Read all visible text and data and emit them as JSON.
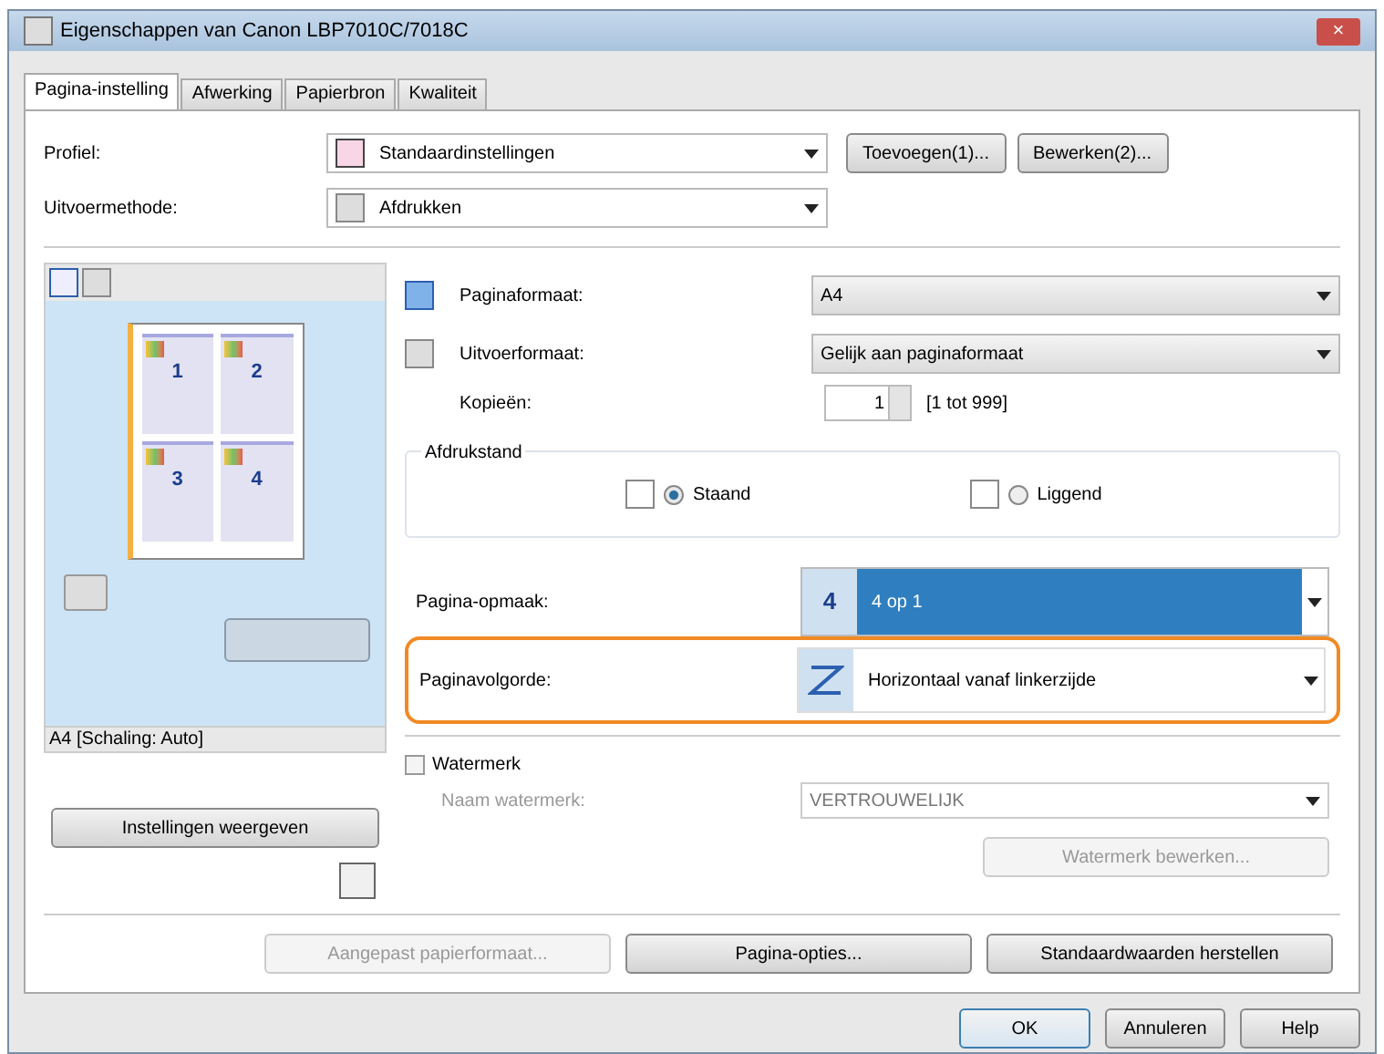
{
  "window": {
    "title": "Eigenschappen van Canon LBP7010C/7018C",
    "close": "×"
  },
  "tabs": [
    {
      "label": "Pagina-instelling",
      "selected": true
    },
    {
      "label": "Afwerking",
      "selected": false
    },
    {
      "label": "Papierbron",
      "selected": false
    },
    {
      "label": "Kwaliteit",
      "selected": false
    }
  ],
  "profile": {
    "label": "Profiel:",
    "value": "Standaardinstellingen",
    "buttons": [
      "Toevoegen(1)...",
      "Bewerken(2)..."
    ]
  },
  "output_method": {
    "label": "Uitvoermethode:",
    "value": "Afdrukken"
  },
  "preview": {
    "pages": [
      "1",
      "2",
      "3",
      "4"
    ],
    "caption": "A4 [Schaling: Auto]",
    "show_settings": "Instellingen weergeven"
  },
  "page_size": {
    "label": "Paginaformaat:",
    "value": "A4"
  },
  "output_size": {
    "label": "Uitvoerformaat:",
    "value": "Gelijk aan paginaformaat"
  },
  "copies": {
    "label": "Kopieën:",
    "value": "1",
    "range": "[1 tot 999]"
  },
  "orientation": {
    "label": "Afdrukstand",
    "options": [
      {
        "label": "Staand",
        "selected": true
      },
      {
        "label": "Liggend",
        "selected": false
      }
    ]
  },
  "layout": {
    "label": "Pagina-opmaak:",
    "badge": "4",
    "value": "4 op 1"
  },
  "order": {
    "label": "Paginavolgorde:",
    "value": "Horizontaal vanaf linkerzijde",
    "highlighted": true
  },
  "watermark": {
    "label": "Watermerk",
    "checked": false,
    "name_label": "Naam watermerk:",
    "name_value": "VERTROUWELIJK",
    "edit_button": "Watermerk bewerken..."
  },
  "panel_buttons": [
    {
      "label": "Aangepast papierformaat...",
      "disabled": true
    },
    {
      "label": "Pagina-opties...",
      "disabled": false
    },
    {
      "label": "Standaardwaarden herstellen",
      "disabled": false
    }
  ],
  "dialog_buttons": [
    {
      "label": "OK",
      "default": true
    },
    {
      "label": "Annuleren",
      "default": false
    },
    {
      "label": "Help",
      "default": false
    }
  ]
}
